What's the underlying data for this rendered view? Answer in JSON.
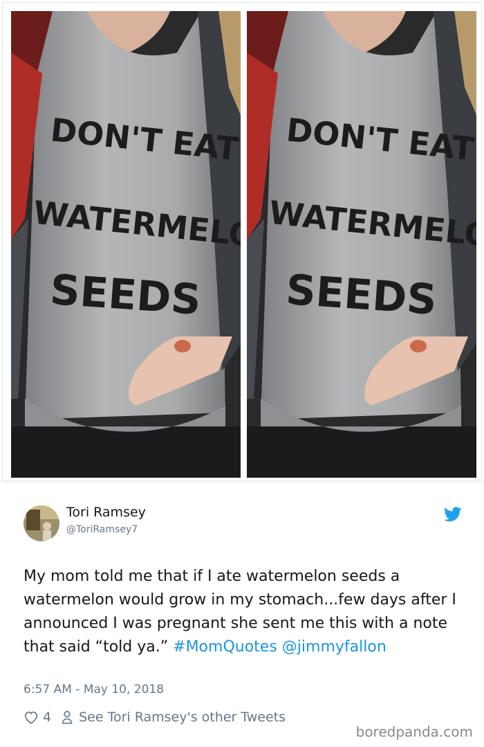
{
  "photos": {
    "shirt_text": [
      "DON'T EAT",
      "WATERMELON",
      "SEEDS"
    ]
  },
  "tweet": {
    "author_name": "Tori Ramsey",
    "author_handle": "@ToriRamsey7",
    "text_main": "My mom told me that if I ate watermelon seeds a watermelon would grow in my stomach...few days after I announced I was pregnant she sent me this with a note that said “told ya.”",
    "hashtag": "#MomQuotes",
    "mention": "@jimmyfallon",
    "timestamp": "6:57 AM - May 10, 2018",
    "like_count": "4",
    "other_tweets_link": "See Tori Ramsey's other Tweets"
  },
  "icons": [
    "twitter-bird-icon",
    "heart-icon",
    "person-icon"
  ],
  "colors": {
    "link": "#1b95e0",
    "meta": "#657786",
    "text": "#14171a",
    "bird": "#1da1f2"
  },
  "watermark": "boredpanda.com"
}
